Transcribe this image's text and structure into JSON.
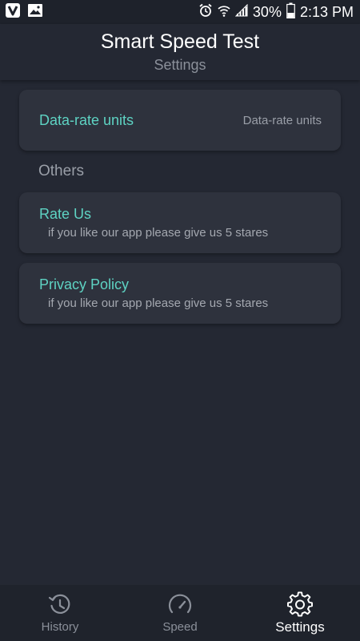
{
  "status_bar": {
    "left_icons": [
      "v-app-icon",
      "image-icon"
    ],
    "right_icons": [
      "alarm-icon",
      "wifi-icon",
      "signal-icon",
      "battery-icon"
    ],
    "battery": "30%",
    "time": "2:13 PM"
  },
  "header": {
    "title": "Smart Speed Test",
    "subtitle": "Settings"
  },
  "settings": {
    "data_rate": {
      "label": "Data-rate units",
      "value": "Data-rate units"
    },
    "others_heading": "Others",
    "rate_us": {
      "label": "Rate Us",
      "description": "if you like our app please give us 5 stares"
    },
    "privacy_policy": {
      "label": "Privacy Policy",
      "description": "if you like our app please give us 5 stares"
    }
  },
  "bottom_nav": {
    "items": [
      {
        "label": "History",
        "icon": "history-icon",
        "active": false
      },
      {
        "label": "Speed",
        "icon": "speedometer-icon",
        "active": false
      },
      {
        "label": "Settings",
        "icon": "gear-icon",
        "active": true
      }
    ]
  },
  "colors": {
    "background": "#242833",
    "card": "#2e323d",
    "accent": "#5ed3c3",
    "muted_text": "#9a9fa8",
    "nav_background": "#1f232c"
  }
}
